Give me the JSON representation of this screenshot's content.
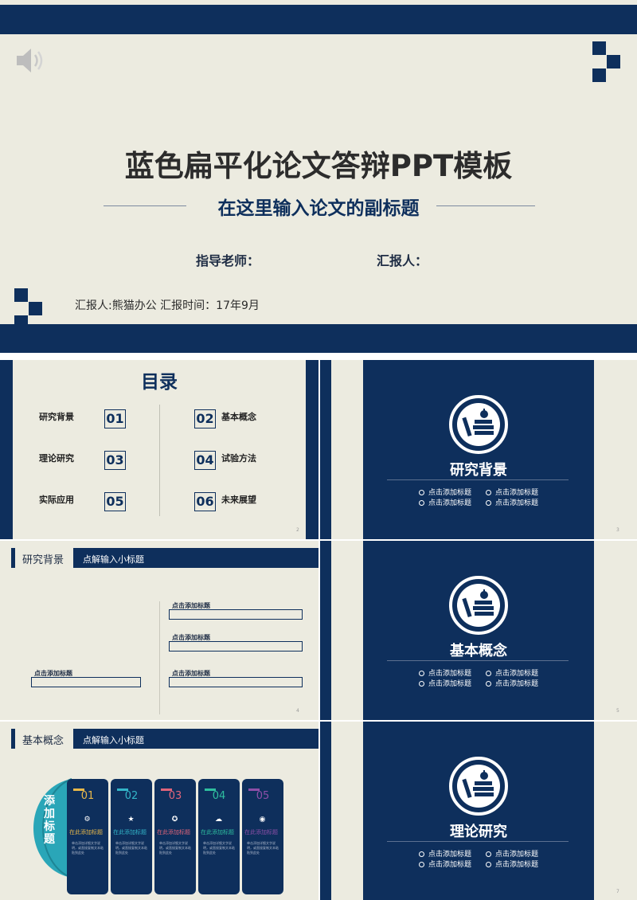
{
  "cover": {
    "title": "蓝色扁平化论文答辩PPT模板",
    "subtitle": "在这里输入论文的副标题",
    "advisor_label": "指导老师：",
    "reporter_label": "汇报人：",
    "info": "汇报人:熊猫办公    汇报时间：17年9月"
  },
  "toc": {
    "title": "目录",
    "page": "2",
    "items": [
      {
        "num": "01",
        "label": "研究背景"
      },
      {
        "num": "02",
        "label": "基本概念"
      },
      {
        "num": "03",
        "label": "理论研究"
      },
      {
        "num": "04",
        "label": "试验方法"
      },
      {
        "num": "05",
        "label": "实际应用"
      },
      {
        "num": "06",
        "label": "未来展望"
      }
    ]
  },
  "sections": [
    {
      "heading": "研究背景",
      "page": "3",
      "items": [
        "点击添加标题",
        "点击添加标题",
        "点击添加标题",
        "点击添加标题"
      ]
    },
    {
      "heading": "基本概念",
      "page": "5",
      "items": [
        "点击添加标题",
        "点击添加标题",
        "点击添加标题",
        "点击添加标题"
      ]
    },
    {
      "heading": "理论研究",
      "page": "7",
      "items": [
        "点击添加标题",
        "点击添加标题",
        "点击添加标题",
        "点击添加标题"
      ]
    }
  ],
  "slide4": {
    "header_title": "研究背景",
    "header_sub": "点解输入小标题",
    "page": "4",
    "boxes": [
      "点击添加标题",
      "点击添加标题",
      "点击添加标题",
      "点击添加标题"
    ]
  },
  "slide6": {
    "header_title": "基本概念",
    "header_sub": "点解输入小标题",
    "side_label": "添加标题",
    "cards": [
      {
        "num": "01",
        "title": "在此添加标题",
        "icon": "gear-icon",
        "color": "#e8b84a",
        "text": "单击添加详细文字说明，或直接复制文本粘贴到此处"
      },
      {
        "num": "02",
        "title": "在此添加标题",
        "icon": "star-icon",
        "color": "#33b5c8",
        "text": "单击添加详细文字说明，或直接复制文本粘贴到此处"
      },
      {
        "num": "03",
        "title": "在此添加标题",
        "icon": "star-badge-icon",
        "color": "#e0647a",
        "text": "单击添加详细文字说明，或直接复制文本粘贴到此处"
      },
      {
        "num": "04",
        "title": "在此添加标题",
        "icon": "chat-icon",
        "color": "#2fbf9f",
        "text": "单击添加详细文字说明，或直接复制文本粘贴到此处"
      },
      {
        "num": "05",
        "title": "在此添加标题",
        "icon": "weibo-icon",
        "color": "#8e4fa8",
        "text": "单击添加详细文字说明，或直接复制文本粘贴到此处"
      }
    ]
  },
  "colors": {
    "navy": "#0e2f5c",
    "cream": "#ecebe0",
    "teal": "#2aa6b8"
  }
}
